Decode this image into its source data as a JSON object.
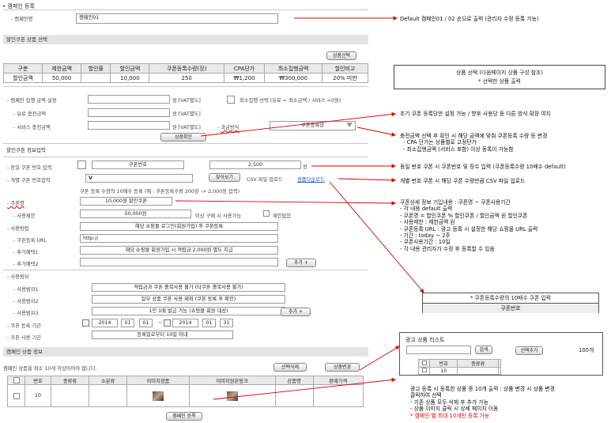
{
  "title": "캠페인 등록",
  "campaign": {
    "label": "- 캠페인명",
    "value": "캠페인01"
  },
  "product_section": {
    "title": "할인쿠폰 상품 선택",
    "select_button": "상품선택"
  },
  "summary_table": {
    "headers": [
      "구분",
      "제한금액",
      "할인률",
      "할인금액",
      "쿠폰등록수량(장)",
      "CPA단가",
      "최소집행금액",
      "할인비고"
    ],
    "row": [
      "할인금액",
      "50,000",
      "",
      "10,000",
      "250",
      "₩1,200",
      "₩300,000",
      "20% 미만"
    ]
  },
  "budget": {
    "label": "- 캠페인 집행 금액 설정",
    "unit": "원 [VAT별도]",
    "min_label": "최소집행 선택 (유료 = 최소금액 / 서비스 =0원)",
    "paid_label": "- 유료 충전금액",
    "service_label": "- 서비스 충전금액",
    "method_label": "과금방식",
    "method_value": "쿠폰등록당",
    "confirm_button": "상품확인"
  },
  "coupon_section": {
    "title": "할인쿠폰 정보입력",
    "same_label": "- 동일 쿠폰 번호 입력",
    "same_value": "쿠폰번호",
    "same_count": "2,500",
    "same_unit": "장",
    "indiv_label": "- 개별 쿠폰 번호입력",
    "indiv_check": "V",
    "browse_button": "찾아보기",
    "csv_label": "CSV 파일 업로드",
    "csv_link": "샘플다운로드",
    "indiv_hint": "쿠폰 등록 수량의 10배수 등록 (예 : 쿠폰등록수량 200장 -> 2,000장 입력)",
    "name_label": "- 쿠폰명",
    "name_value": "10,000원 할인쿠폰",
    "limit_label": "- 사용제한",
    "limit_value": "50,000원",
    "limit_suffix": "이상 구매 시 사용가능",
    "unlimited": "제한없음",
    "method_label": "- 사용방법",
    "method_value": "해당 쇼핑몰 로그인(회원가입) 후 쿠폰등록",
    "url_label": "- 쿠폰등록 URL",
    "url_value": "http://",
    "benefit1_label": "- 추가혜택1",
    "benefit1_value": "해당 쇼핑몰 회원가입 시 적립금 2,000원 별도 지급",
    "benefit2_label": "- 추가혜택2",
    "add_button": "추가 +"
  },
  "scope": {
    "label": "- 사용범위",
    "items": [
      {
        "label": "- 사용범위1",
        "value": "적립금과 쿠폰 중복사용 불가 (타쿠폰 중복사용 불가)"
      },
      {
        "label": "- 사용범위2",
        "value": "일부 상품 쿠폰 사용 제외 (쿠폰 등록 후 확인)"
      },
      {
        "label": "- 사용범위3",
        "value": "1인 1매 발급 가능 (쇼핑몰 회원 대상)"
      }
    ],
    "add_button": "추가 +"
  },
  "period": {
    "label": "- 쿠폰 등록 기간",
    "start": {
      "y": "2014",
      "m": "01",
      "d": "01"
    },
    "tilde": "~",
    "end": {
      "y": "2014",
      "m": "01",
      "d": "31"
    },
    "use_label": "- 쿠폰 사용 기간",
    "use_value": "등록일로부터 10일 이내"
  },
  "campaign_products": {
    "title": "캠페인 상품 정보",
    "hint": "캠페인 상품을 최소 10개 이상이어야 합니다.",
    "delete_button": "선택삭제",
    "change_button": "상품변경",
    "headers": [
      "",
      "번호",
      "종류류",
      "소분류",
      "이미지광품",
      "이미지원본링크",
      "상품명",
      "판매가격"
    ],
    "row": [
      "",
      "10",
      "",
      "",
      "",
      "",
      "",
      ""
    ],
    "register_button": "캠페인 등록"
  },
  "notes": {
    "n1": "Default 캠페인01 / 02 순으로 출력 (관리자 수정 등록 가능)",
    "box1": [
      "상품 선택 (다음페이지 상품 구성 참조)",
      "* 선택한 상품 출력"
    ],
    "n2": "초기 쿠폰 등록당만 설정 가능 / 향후 사용당 등 다른 방식 확장 여지",
    "n3": [
      "충전금액 선택 후 확인 시 해당 금액에 맞춰 쿠폰등록 수량 등 변경",
      "- CPA 단가는 상품별로 고정단가",
      "- 최소집행금액 (서비스 포함) 이상 등록이 가능함"
    ],
    "n4": "동일 번호 쿠폰 시 쿠폰번호 및 장수 입력 (쿠폰등록수량 10배수 default)",
    "n5": "개별 번호 쿠폰 시 해당 쿠폰 수량만큼 CSV 파일 업로드",
    "n6": [
      "쿠폰상세 정보 기입내용 : 쿠폰명 ~ 쿠폰사용기간",
      " - 각 내용 default 출력",
      " - 쿠폰명 = 할인쿠폰 % 할인쿠폰 / 할인금액 원 할인쿠폰",
      " - 사용제한 : 제한금액 원",
      " - 쿠폰등록 URL : 광고 등록 시 설정한 해당 쇼핑몰 URL 출력",
      " - 기간 : today ~ 2주",
      " - 쿠폰사용기간 : 10일",
      " - 각 내용 관리자가 수정 후 등록할 수 있음"
    ],
    "csv_box": [
      "* 쿠폰등록수량의 10배수 쿠폰 입력",
      "쿠폰번호"
    ],
    "list": {
      "title": "광고 상품 리스트",
      "search": "검색",
      "add": "선택추가",
      "count": "100개",
      "headers": [
        "",
        "번호",
        "종류류",
        ""
      ],
      "row": [
        "",
        "10",
        "",
        ""
      ]
    },
    "n7": [
      "광고 등록 시 등록한 상품 중 10개 출력 : 상품 변경 시 상품 변경",
      "클릭하여 선택",
      "  - 기존 상품 모두 삭제 후 추가 가능",
      "  - 상품 이미지 클릭 시 상세 페이지 이동"
    ],
    "n7_red": "* 캠페인 별 최대 10개만 등록 가능"
  },
  "colors": {
    "arrow": "#e00000",
    "bar": "#e4e4e4"
  }
}
